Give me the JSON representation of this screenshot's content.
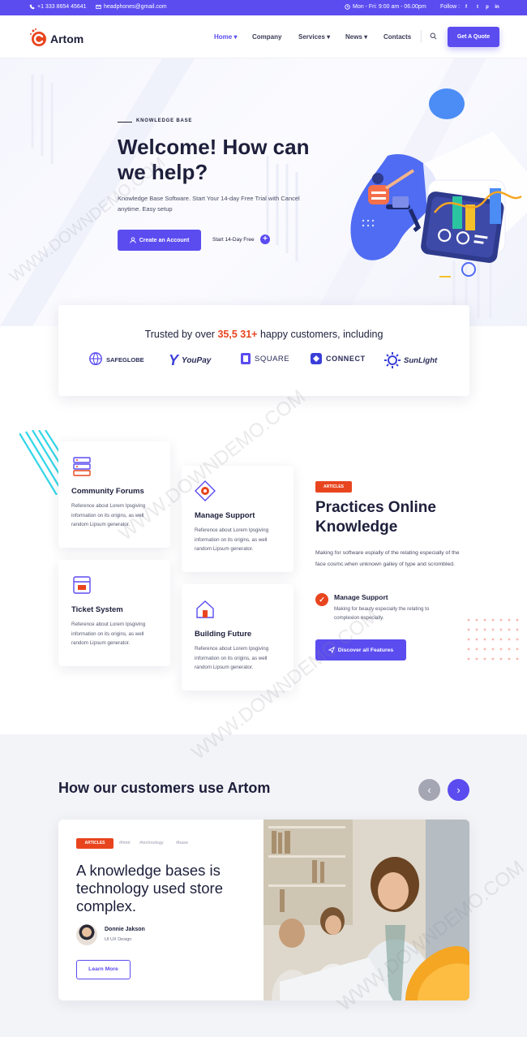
{
  "topbar": {
    "phone": "+1 333 8654 45641",
    "email": "headphones@gmail.com",
    "hours": "Mon - Fri: 9:00 am - 06.00pm",
    "follow": "Follow :",
    "social": [
      "f",
      "t",
      "p",
      "in"
    ]
  },
  "header": {
    "logo_text": "Artom",
    "nav": [
      "Home",
      "Company",
      "Services",
      "News",
      "Contacts"
    ],
    "cta": "Get A Quote"
  },
  "hero": {
    "eyebrow": "KNOWLEDGE BASE",
    "title": "Welcome! How can we help?",
    "subtitle": "Knowledge Base Software. Start Your 14-day Free Trial with Cancel anytime. Easy setup",
    "primary_btn": "Create an Account",
    "secondary_link": "Start 14-Day Free"
  },
  "trusted": {
    "prefix": "Trusted by over",
    "number": "35,5 31+",
    "suffix": "happy customers, including",
    "brands": [
      "SAFEGLOBE",
      "YouPay",
      "SQUARE",
      "CONNECT",
      "SunLight"
    ]
  },
  "features": {
    "cards": [
      {
        "title": "Community Forums",
        "desc": "Reference about Lorem Ipsgiving information on its origins, as well random Lipsum generator."
      },
      {
        "title": "Manage Support",
        "desc": "Reference about Lorem Ipsgiving information on its origins, as well random Lipsum generator."
      },
      {
        "title": "Ticket System",
        "desc": "Reference about Lorem Ipsgiving information on its origins, as well random Lipsum generator."
      },
      {
        "title": "Building Future",
        "desc": "Reference about Lorem Ipsgiving information on its origins, as well random Lipsum generator."
      }
    ],
    "badge": "ARTICLES",
    "title": "Practices Online Knowledge",
    "paragraph": "Making for software espially of the relating especially of the face cosmc.when unknown galley of type and scrombled.",
    "item_title": "Manage Support",
    "item_desc": "Making for beauty especially the relating to complexion especially.",
    "cta": "Discover all Features"
  },
  "customers": {
    "title": "How our customers use Artom",
    "article": {
      "badge": "ARTICLES",
      "tags": [
        "#html",
        "#technology",
        "#base"
      ],
      "title": "A knowledge bases is technology used store complex.",
      "author": "Donnie Jakson",
      "role": "UI UX Design",
      "cta": "Learn More"
    }
  },
  "watermark": "WWW.DOWNDEMO.COM",
  "colors": {
    "primary": "#5b4cf0",
    "accent": "#e8451f",
    "dark": "#1d1f3b"
  }
}
